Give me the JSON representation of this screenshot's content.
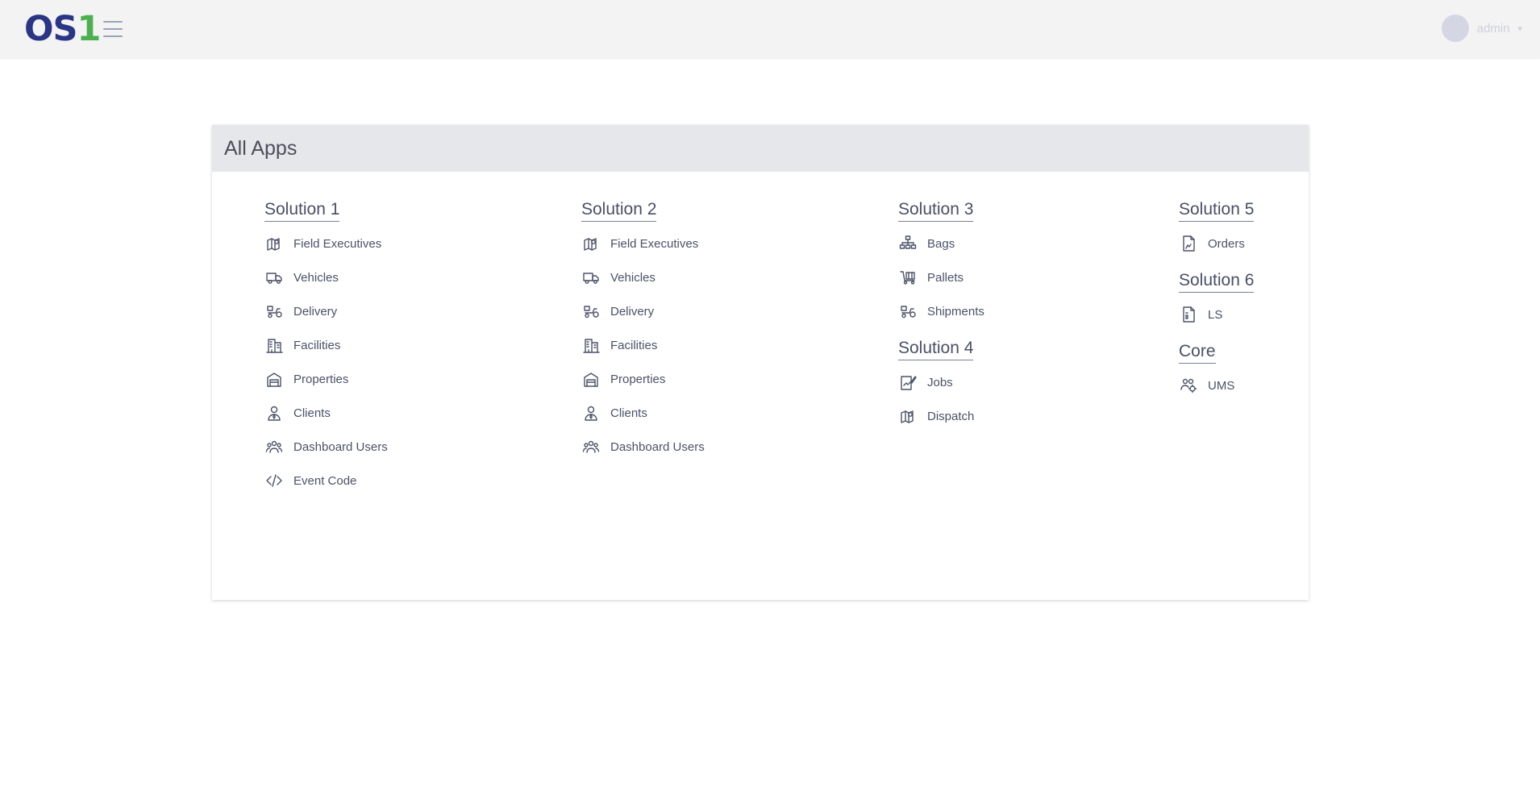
{
  "app": {
    "logo_main": "OS",
    "logo_num": "1",
    "user_name": "admin"
  },
  "panel": {
    "title": "All Apps"
  },
  "columns": [
    {
      "groups": [
        {
          "title": "Solution 1",
          "items": [
            {
              "label": "Field Executives",
              "icon": "map-icon"
            },
            {
              "label": "Vehicles",
              "icon": "truck-icon"
            },
            {
              "label": "Delivery",
              "icon": "delivery-icon"
            },
            {
              "label": "Facilities",
              "icon": "building-icon"
            },
            {
              "label": "Properties",
              "icon": "warehouse-icon"
            },
            {
              "label": "Clients",
              "icon": "client-icon"
            },
            {
              "label": "Dashboard Users",
              "icon": "users-icon"
            },
            {
              "label": "Event Code",
              "icon": "code-icon"
            }
          ]
        }
      ]
    },
    {
      "groups": [
        {
          "title": "Solution 2",
          "items": [
            {
              "label": "Field Executives",
              "icon": "map-icon"
            },
            {
              "label": "Vehicles",
              "icon": "truck-icon"
            },
            {
              "label": "Delivery",
              "icon": "delivery-icon"
            },
            {
              "label": "Facilities",
              "icon": "building-icon"
            },
            {
              "label": "Properties",
              "icon": "warehouse-icon"
            },
            {
              "label": "Clients",
              "icon": "client-icon"
            },
            {
              "label": "Dashboard Users",
              "icon": "users-icon"
            }
          ]
        }
      ]
    },
    {
      "groups": [
        {
          "title": "Solution 3",
          "items": [
            {
              "label": "Bags",
              "icon": "hierarchy-icon"
            },
            {
              "label": "Pallets",
              "icon": "pallet-icon"
            },
            {
              "label": "Shipments",
              "icon": "delivery-icon"
            }
          ]
        },
        {
          "title": "Solution 4",
          "items": [
            {
              "label": "Jobs",
              "icon": "jobs-icon"
            },
            {
              "label": "Dispatch",
              "icon": "map-icon"
            }
          ]
        }
      ]
    },
    {
      "groups": [
        {
          "title": "Solution 5",
          "items": [
            {
              "label": "Orders",
              "icon": "document-icon"
            }
          ]
        },
        {
          "title": "Solution 6",
          "items": [
            {
              "label": "LS",
              "icon": "file-icon"
            }
          ]
        },
        {
          "title": "Core",
          "items": [
            {
              "label": "UMS",
              "icon": "users-gear-icon"
            }
          ]
        }
      ]
    }
  ]
}
